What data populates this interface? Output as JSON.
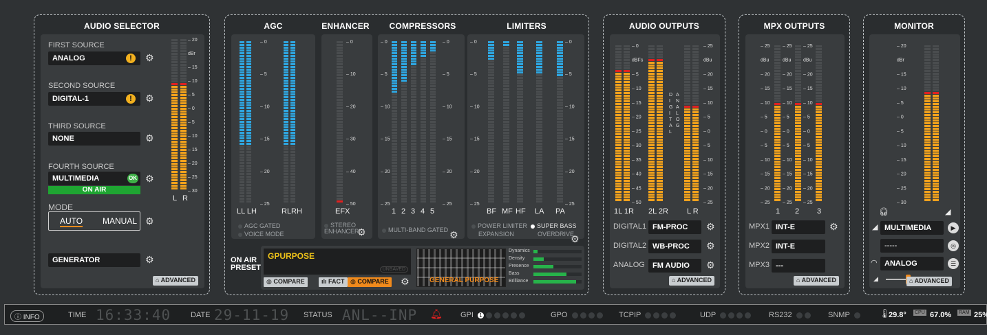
{
  "colors": {
    "accent_orange": "#f08a1c",
    "onair_green": "#1fa532",
    "meter_blue": "#2fa6e0",
    "meter_orange": "#f2a21c",
    "meter_red": "#e02020",
    "gp_yellow": "#f0c419"
  },
  "audio_selector": {
    "title": "AUDIO SELECTOR",
    "sources": [
      {
        "label": "FIRST SOURCE",
        "value": "ANALOG",
        "status": "warn"
      },
      {
        "label": "SECOND SOURCE",
        "value": "DIGITAL-1",
        "status": "warn"
      },
      {
        "label": "THIRD SOURCE",
        "value": "NONE",
        "status": ""
      },
      {
        "label": "FOURTH SOURCE",
        "value": "MULTIMEDIA",
        "status": "OK"
      }
    ],
    "on_air": "ON AIR",
    "mode_label": "MODE",
    "mode_auto": "AUTO",
    "mode_manual": "MANUAL",
    "generator": "GENERATOR",
    "advanced": "ADVANCED",
    "meter_scale": [
      "20",
      "dBr",
      "15",
      "10",
      "5",
      "0",
      "5",
      "10",
      "15",
      "20",
      "25",
      "30"
    ],
    "meter_labels": [
      "L",
      "R"
    ],
    "levels": [
      0.71,
      0.71
    ]
  },
  "processing": {
    "agc_title": "AGC",
    "enhancer_title": "ENHANCER",
    "compressors_title": "COMPRESSORS",
    "limiters_title": "LIMITERS",
    "agc_scale": [
      "0",
      "5",
      "10",
      "15",
      "20",
      "25"
    ],
    "agc_labels": [
      "LL LH",
      "RLRH"
    ],
    "agc_levels": [
      0.64,
      0.64,
      0.64,
      0.64
    ],
    "agc_options": [
      "AGC GATED",
      "VOICE MODE"
    ],
    "enhancer_scale": [
      "0",
      "10",
      "20",
      "30",
      "40",
      "50"
    ],
    "enhancer_label": "EFX",
    "enhancer_option": "STEREO ENHANCER",
    "comp_scale": [
      "0",
      "5",
      "10",
      "15",
      "20",
      "25"
    ],
    "comp_labels": [
      "1",
      "2",
      "3",
      "4",
      "5"
    ],
    "comp_levels": [
      0.32,
      0.25,
      0.16,
      0.1,
      0.06
    ],
    "comp_option": "MULTI-BAND GATED",
    "lim_scale": [
      "0",
      "5",
      "10",
      "15",
      "20",
      "25"
    ],
    "lim_labels": [
      "BF",
      "MF",
      "HF",
      "LA",
      "PA"
    ],
    "lim_levels": [
      0.12,
      0.04,
      0.2,
      0.2,
      0.22
    ],
    "lim_options": [
      "POWER LIMITER",
      "SUPER BASS",
      "EXPANSION",
      "OVERDRIVE"
    ]
  },
  "preset": {
    "label": "ON AIR PRESET",
    "name": "GPURPOSE",
    "compare": "COMPARE",
    "fact": "FACT",
    "image_caption": "GENERAL PURPOSE",
    "tag": "UNSAVED",
    "bars": [
      {
        "name": "Dynamics",
        "value": 0.08
      },
      {
        "name": "Density",
        "value": 0.22
      },
      {
        "name": "Presence",
        "value": 0.42
      },
      {
        "name": "Bass",
        "value": 0.68
      },
      {
        "name": "Brilliance",
        "value": 0.88
      }
    ]
  },
  "audio_outputs": {
    "title": "AUDIO OUTPUTS",
    "left_scale": [
      "0",
      "dBFs",
      "5",
      "10",
      "15",
      "20",
      "25",
      "30",
      "35",
      "40",
      "45",
      "50"
    ],
    "right_scale": [
      "25",
      "dBu",
      "20",
      "15",
      "10",
      "5",
      "0",
      "5",
      "10",
      "15",
      "20",
      "25"
    ],
    "digital_word": "DIGITAL",
    "analog_word": "ANALOG",
    "meter_labels": [
      "1L 1R",
      "2L 2R",
      "L R"
    ],
    "levels": [
      0.84,
      0.84,
      0.92,
      0.92,
      0.62,
      0.62
    ],
    "outputs": [
      {
        "label": "DIGITAL1",
        "value": "FM-PROC"
      },
      {
        "label": "DIGITAL2",
        "value": "WB-PROC"
      },
      {
        "label": "ANALOG",
        "value": "FM AUDIO"
      }
    ],
    "advanced": "ADVANCED"
  },
  "mpx_outputs": {
    "title": "MPX OUTPUTS",
    "scale": [
      "25",
      "dBu",
      "20",
      "15",
      "10",
      "5",
      "0",
      "5",
      "10",
      "15",
      "20",
      "25"
    ],
    "meter_labels": [
      "1",
      "2",
      "3"
    ],
    "levels": [
      0.63,
      0.63,
      0.63
    ],
    "outputs": [
      {
        "label": "MPX1",
        "value": "INT-E"
      },
      {
        "label": "MPX2",
        "value": "INT-E"
      },
      {
        "label": "MPX3",
        "value": "---"
      }
    ],
    "advanced": "ADVANCED"
  },
  "monitor": {
    "title": "MONITOR",
    "scale": [
      "20",
      "dBr",
      "15",
      "10",
      "5",
      "0",
      "5",
      "10",
      "15",
      "20",
      "25",
      "30"
    ],
    "levels": [
      0.71,
      0.71
    ],
    "source1": "MULTIMEDIA",
    "source2": "-----",
    "source3": "ANALOG",
    "volume": 0.4,
    "advanced": "ADVANCED"
  },
  "statusbar": {
    "info": "INFO",
    "time_label": "TIME",
    "time": "16:33:40",
    "date_label": "DATE",
    "date": "29-11-19",
    "status_label": "STATUS",
    "status": "ANL--INP",
    "gpi": "GPI",
    "gpi_first": "1",
    "gpo": "GPO",
    "tcpip": "TCPIP",
    "udp": "UDP",
    "rs232": "RS232",
    "snmp": "SNMP",
    "temp": "29.8°",
    "cpu": "67.0%",
    "ram": "25%"
  }
}
